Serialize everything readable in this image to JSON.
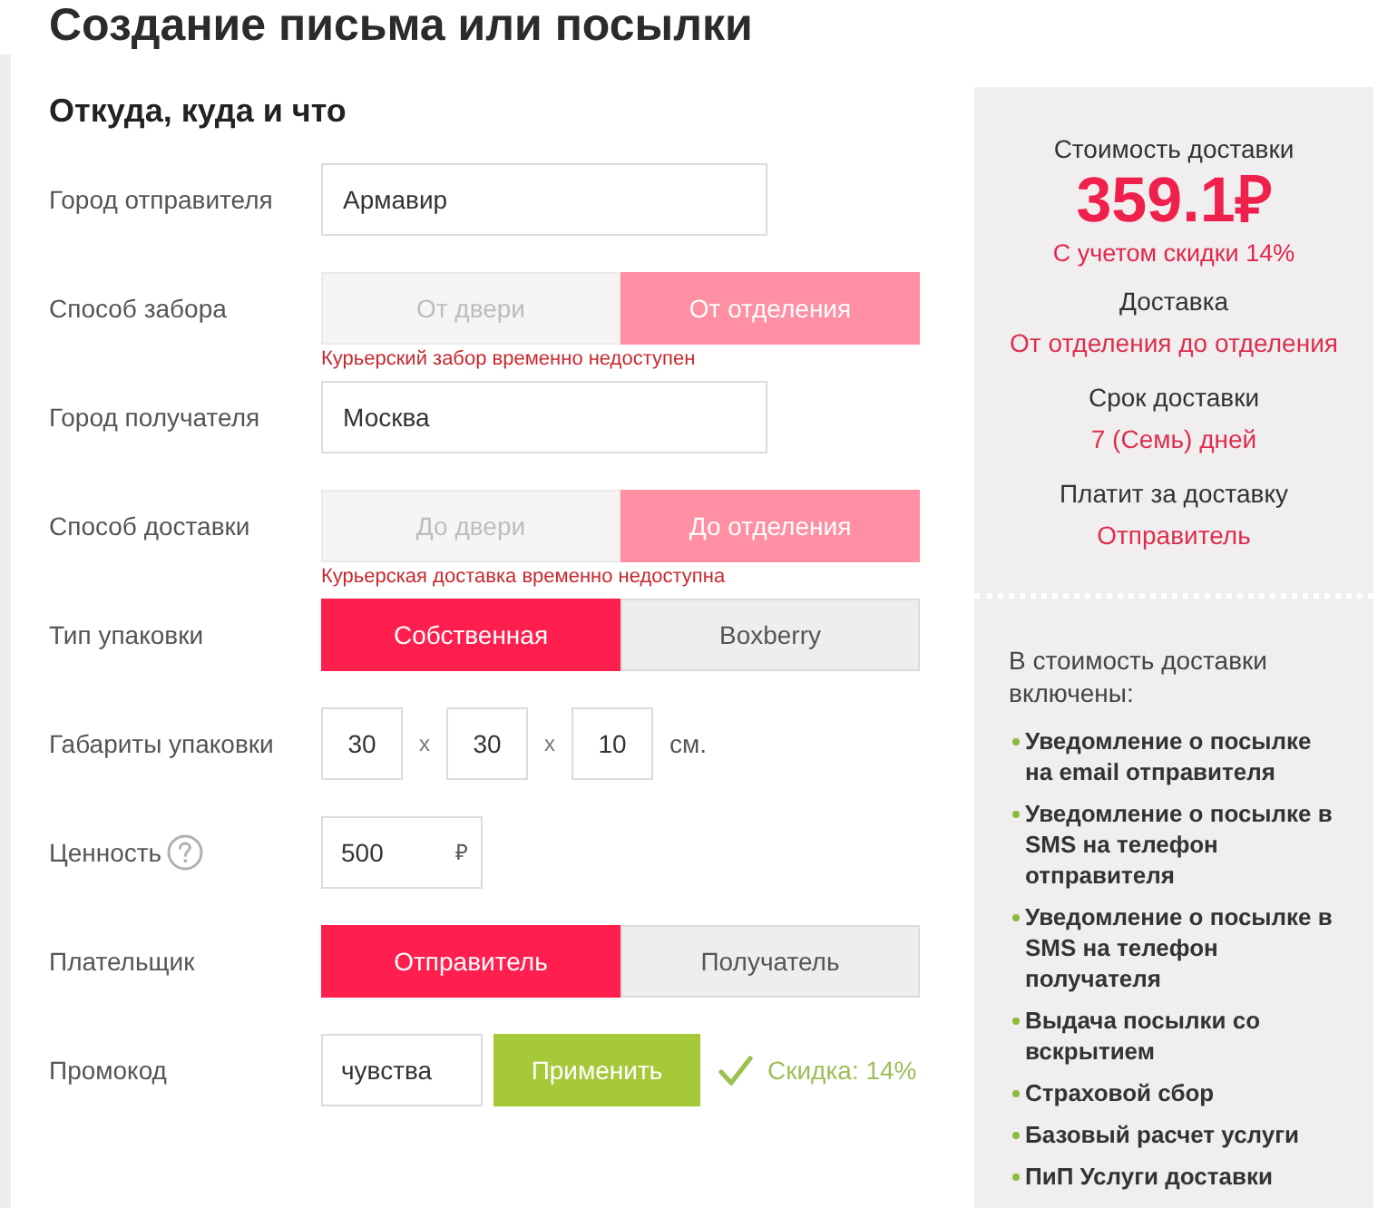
{
  "page": {
    "title": "Создание письма или посылки"
  },
  "form": {
    "heading": "Откуда, куда и что",
    "rows": [
      {
        "kind": "text",
        "label": "Город отправителя",
        "value": "Армавир"
      },
      {
        "kind": "toggle",
        "label": "Способ забора",
        "disabled": true,
        "options": [
          {
            "label": "От двери",
            "selected": false
          },
          {
            "label": "От отделения",
            "selected": true
          }
        ],
        "error": "Курьерский забор временно недоступен"
      },
      {
        "kind": "text",
        "label": "Город получателя",
        "value": "Москва"
      },
      {
        "kind": "toggle",
        "label": "Способ доставки",
        "disabled": true,
        "options": [
          {
            "label": "До двери",
            "selected": false
          },
          {
            "label": "До отделения",
            "selected": true
          }
        ],
        "error": "Курьерская доставка временно недоступна"
      },
      {
        "kind": "toggle",
        "label": "Тип упаковки",
        "disabled": false,
        "options": [
          {
            "label": "Собственная",
            "selected": true
          },
          {
            "label": "Boxberry",
            "selected": false
          }
        ]
      },
      {
        "kind": "dimensions",
        "label": "Габариты упаковки",
        "values": [
          "30",
          "30",
          "10"
        ],
        "separators": [
          "x",
          "x"
        ],
        "unit": "см."
      },
      {
        "kind": "money",
        "label": "Ценность",
        "help": true,
        "value": "500",
        "currency": "₽"
      },
      {
        "kind": "toggle",
        "label": "Плательщик",
        "disabled": false,
        "options": [
          {
            "label": "Отправитель",
            "selected": true
          },
          {
            "label": "Получатель",
            "selected": false
          }
        ]
      },
      {
        "kind": "promo",
        "label": "Промокод",
        "value": "чувства",
        "button": "Применить",
        "applied": true,
        "result": "Скидка: 14%"
      }
    ]
  },
  "summary": {
    "cost_label": "Стоимость доставки",
    "price": "359.1₽",
    "discount_note": "С учетом скидки 14%",
    "details": [
      {
        "label": "Доставка",
        "value": "От отделения до отделения"
      },
      {
        "label": "Срок доставки",
        "value": "7 (Семь) дней"
      },
      {
        "label": "Платит за доставку",
        "value": "Отправитель"
      }
    ],
    "included_heading": "В стоимость доставки включены:",
    "included": [
      "Уведомление о посылке на email отправителя",
      "Уведомление о посылке в SMS на телефон отправителя",
      "Уведомление о посылке в SMS на телефон получателя",
      "Выдача посылки со вскрытием",
      "Страховой сбор",
      "Базовый расчет услуги",
      "ПиП Услуги доставки"
    ]
  }
}
